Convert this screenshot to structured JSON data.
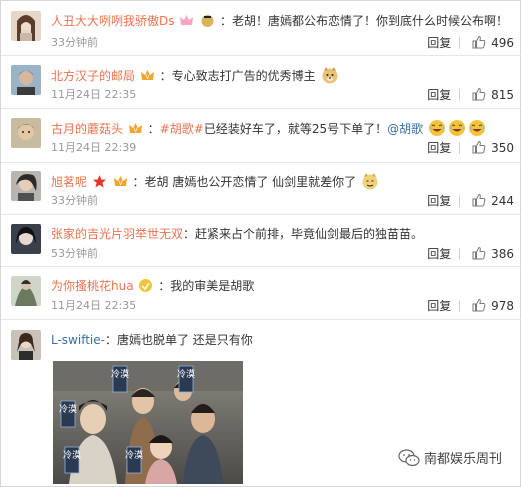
{
  "comments": [
    {
      "username": "人丑大大咧咧我骄傲Ds",
      "text": "：老胡！唐嫣都公布恋情了！你到底什么时候公布啊！",
      "time": "33分钟前",
      "reply_label": "回复",
      "likes": "496"
    },
    {
      "username": "北方汉子的邮局",
      "text": "：专心致志打广告的优秀博主",
      "time": "11月24日 22:35",
      "reply_label": "回复",
      "likes": "815"
    },
    {
      "username": "古月的蘑菇头",
      "text_prefix": "：",
      "topic": "#胡歌#",
      "text_middle": "已经装好车了，就等25号下单了！",
      "mention": "@胡歌",
      "time": "11月24日 22:39",
      "reply_label": "回复",
      "likes": "350"
    },
    {
      "username": "旭茗呢",
      "text": "：老胡 唐嫣也公开恋情了 仙剑里就差你了",
      "time": "33分钟前",
      "reply_label": "回复",
      "likes": "244"
    },
    {
      "username": "张家的吉光片羽举世无双",
      "text": "：赶紧来占个前排，毕竟仙剑最后的独苗苗。",
      "time": "53分钟前",
      "reply_label": "回复",
      "likes": "386"
    },
    {
      "username": "为你搔桃花hua",
      "text": "：我的审美是胡歌",
      "time": "11月24日 22:35",
      "reply_label": "回复",
      "likes": "978"
    },
    {
      "username": "L-swiftie-",
      "text": "：唐嫣也脱单了    还是只有你"
    }
  ],
  "photo_tags": [
    "冷漠",
    "冷漠",
    "冷漠",
    "冷漠",
    "冷漠"
  ],
  "watermark": "南都娱乐周刊",
  "icons": {
    "like": "thumbs-up-icon",
    "badge": "member-crown-icon",
    "emoji_laugh": "laughing-emoji-icon",
    "emoji_doge": "doge-emoji-icon",
    "watermark": "wechat-logo-icon"
  },
  "colors": {
    "username": "#eb7350",
    "username_blue": "#3b6ea5",
    "meta": "#999999",
    "divider": "#e6e6e6"
  }
}
